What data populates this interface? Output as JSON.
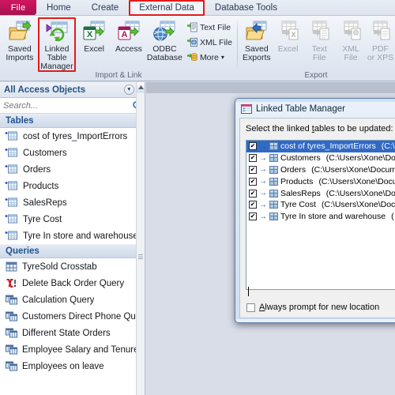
{
  "app": {
    "title": "Microsoft Access"
  },
  "tabs": {
    "file": "File",
    "items": [
      {
        "label": "Home",
        "active": false
      },
      {
        "label": "Create",
        "active": false
      },
      {
        "label": "External Data",
        "active": true
      },
      {
        "label": "Database Tools",
        "active": false
      }
    ]
  },
  "ribbon": {
    "groups": [
      {
        "title": "Import & Link",
        "buttons": [
          {
            "label": "Saved\nImports",
            "label1": "Saved",
            "label2": "Imports",
            "icon": "saved-imports-icon",
            "highlighted": false,
            "disabled": false
          },
          {
            "label": "Linked Table Manager",
            "label1": "Linked Table",
            "label2": "Manager",
            "icon": "linked-table-manager-icon",
            "highlighted": true,
            "disabled": false
          },
          {
            "label": "Excel",
            "label1": "Excel",
            "label2": "",
            "icon": "excel-import-icon",
            "highlighted": false,
            "disabled": false
          },
          {
            "label": "Access",
            "label1": "Access",
            "label2": "",
            "icon": "access-import-icon",
            "highlighted": false,
            "disabled": false
          },
          {
            "label": "ODBC Database",
            "label1": "ODBC",
            "label2": "Database",
            "icon": "odbc-database-icon",
            "highlighted": false,
            "disabled": false
          }
        ],
        "small_buttons": [
          {
            "label": "Text File",
            "icon": "text-file-icon"
          },
          {
            "label": "XML File",
            "icon": "xml-file-icon"
          },
          {
            "label": "More",
            "icon": "more-icon",
            "caret": "▾"
          }
        ]
      },
      {
        "title": "Export",
        "buttons": [
          {
            "label1": "Saved",
            "label2": "Exports",
            "icon": "saved-exports-icon",
            "disabled": false
          },
          {
            "label1": "Excel",
            "label2": "",
            "icon": "excel-export-icon",
            "disabled": true
          },
          {
            "label1": "Text",
            "label2": "File",
            "icon": "text-file-export-icon",
            "disabled": true
          },
          {
            "label1": "XML",
            "label2": "File",
            "icon": "xml-file-export-icon",
            "disabled": true
          },
          {
            "label1": "PDF",
            "label2": "or XPS",
            "icon": "pdf-xps-export-icon",
            "disabled": true
          }
        ]
      }
    ]
  },
  "nav_pane": {
    "header": "All Access Objects",
    "search_placeholder": "Search...",
    "search_value": "",
    "groups": [
      {
        "name": "Tables",
        "items": [
          {
            "label": "cost of tyres_ImportErrors",
            "icon": "linked-table-icon"
          },
          {
            "label": "Customers",
            "icon": "linked-table-icon"
          },
          {
            "label": "Orders",
            "icon": "linked-table-icon"
          },
          {
            "label": "Products",
            "icon": "linked-table-icon"
          },
          {
            "label": "SalesReps",
            "icon": "linked-table-icon"
          },
          {
            "label": "Tyre Cost",
            "icon": "linked-table-icon"
          },
          {
            "label": "Tyre In store and warehouse",
            "icon": "linked-table-icon"
          }
        ]
      },
      {
        "name": "Queries",
        "items": [
          {
            "label": "TyreSold Crosstab",
            "icon": "crosstab-query-icon"
          },
          {
            "label": "Delete Back Order Query",
            "icon": "delete-query-icon"
          },
          {
            "label": "Calculation Query",
            "icon": "select-query-icon"
          },
          {
            "label": "Customers Direct Phone Qu...",
            "icon": "select-query-icon"
          },
          {
            "label": "Different State Orders",
            "icon": "select-query-icon"
          },
          {
            "label": "Employee Salary and Tenure...",
            "icon": "select-query-icon"
          },
          {
            "label": "Employees on leave",
            "icon": "select-query-icon"
          }
        ]
      }
    ]
  },
  "dialog": {
    "title": "Linked Table Manager",
    "icon": "linked-table-manager-dialog-icon",
    "prompt_before": "Select the linked ",
    "prompt_underlined": "t",
    "prompt_after": "ables to be updated:",
    "rows": [
      {
        "name": "cost of tyres_ImportErrors",
        "path": "(C:\\",
        "checked": true,
        "selected": true
      },
      {
        "name": "Customers",
        "path": "(C:\\Users\\Xone\\Doc",
        "checked": true,
        "selected": false
      },
      {
        "name": "Orders",
        "path": "(C:\\Users\\Xone\\Docum",
        "checked": true,
        "selected": false
      },
      {
        "name": "Products",
        "path": "(C:\\Users\\Xone\\Docu",
        "checked": true,
        "selected": false
      },
      {
        "name": "SalesReps",
        "path": "(C:\\Users\\Xone\\Doc",
        "checked": true,
        "selected": false
      },
      {
        "name": "Tyre Cost",
        "path": "(C:\\Users\\Xone\\Docu",
        "checked": true,
        "selected": false
      },
      {
        "name": "Tyre In store and warehouse",
        "path": "(",
        "checked": true,
        "selected": false
      }
    ],
    "always_prompt": {
      "label_underlined": "A",
      "label_rest": "lways prompt for new location",
      "checked": false
    }
  },
  "colors": {
    "file_tab": "#cf1760",
    "highlight_box": "#e21b1b",
    "selection_blue": "#316ac5",
    "nav_group_text": "#215290",
    "workspace_bg": "#d8dde8"
  }
}
